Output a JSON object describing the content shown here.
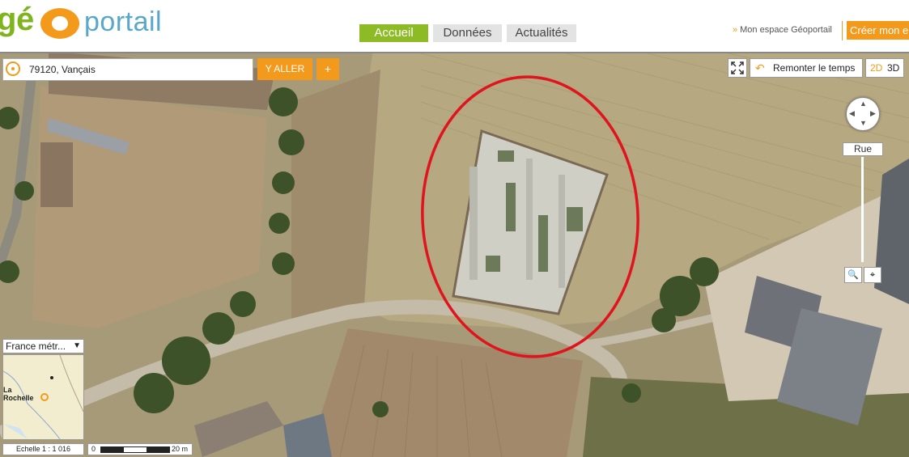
{
  "header": {
    "logo": {
      "text_geo": "géo",
      "text_portail": "portail"
    },
    "nav": [
      {
        "label": "Accueil",
        "active": true
      },
      {
        "label": "Données",
        "active": false
      },
      {
        "label": "Actualités",
        "active": false
      }
    ],
    "espace_link": "Mon espace Géoportail",
    "espace_chevron": "»",
    "create_button": "Créer mon e"
  },
  "search": {
    "value": "79120, Vançais",
    "go_button": "Y ALLER",
    "plus_button": "+",
    "locate_icon": "locate-icon"
  },
  "map_controls": {
    "fullscreen_icon": "fullscreen-icon",
    "remonter_label": "Remonter le temps",
    "remonter_icon": "undo-arrow-icon",
    "mode_2d": "2D",
    "mode_3d": "3D",
    "compass_icon": "compass-pan-icon",
    "zoom_level_label": "Rue",
    "zoom_search_icon": "magnifier-icon",
    "zoom_locate_icon": "crosshair-icon"
  },
  "minimap": {
    "projection": "France métr...",
    "city_label_line1": "La",
    "city_label_line2": "Rochelle"
  },
  "scale": {
    "echelle": "Echelle 1 :  1 016",
    "zero": "0",
    "distance": "20 m"
  },
  "colors": {
    "brand_green": "#8dbb26",
    "brand_orange": "#f39a1c",
    "highlight_red": "#e0141e"
  }
}
